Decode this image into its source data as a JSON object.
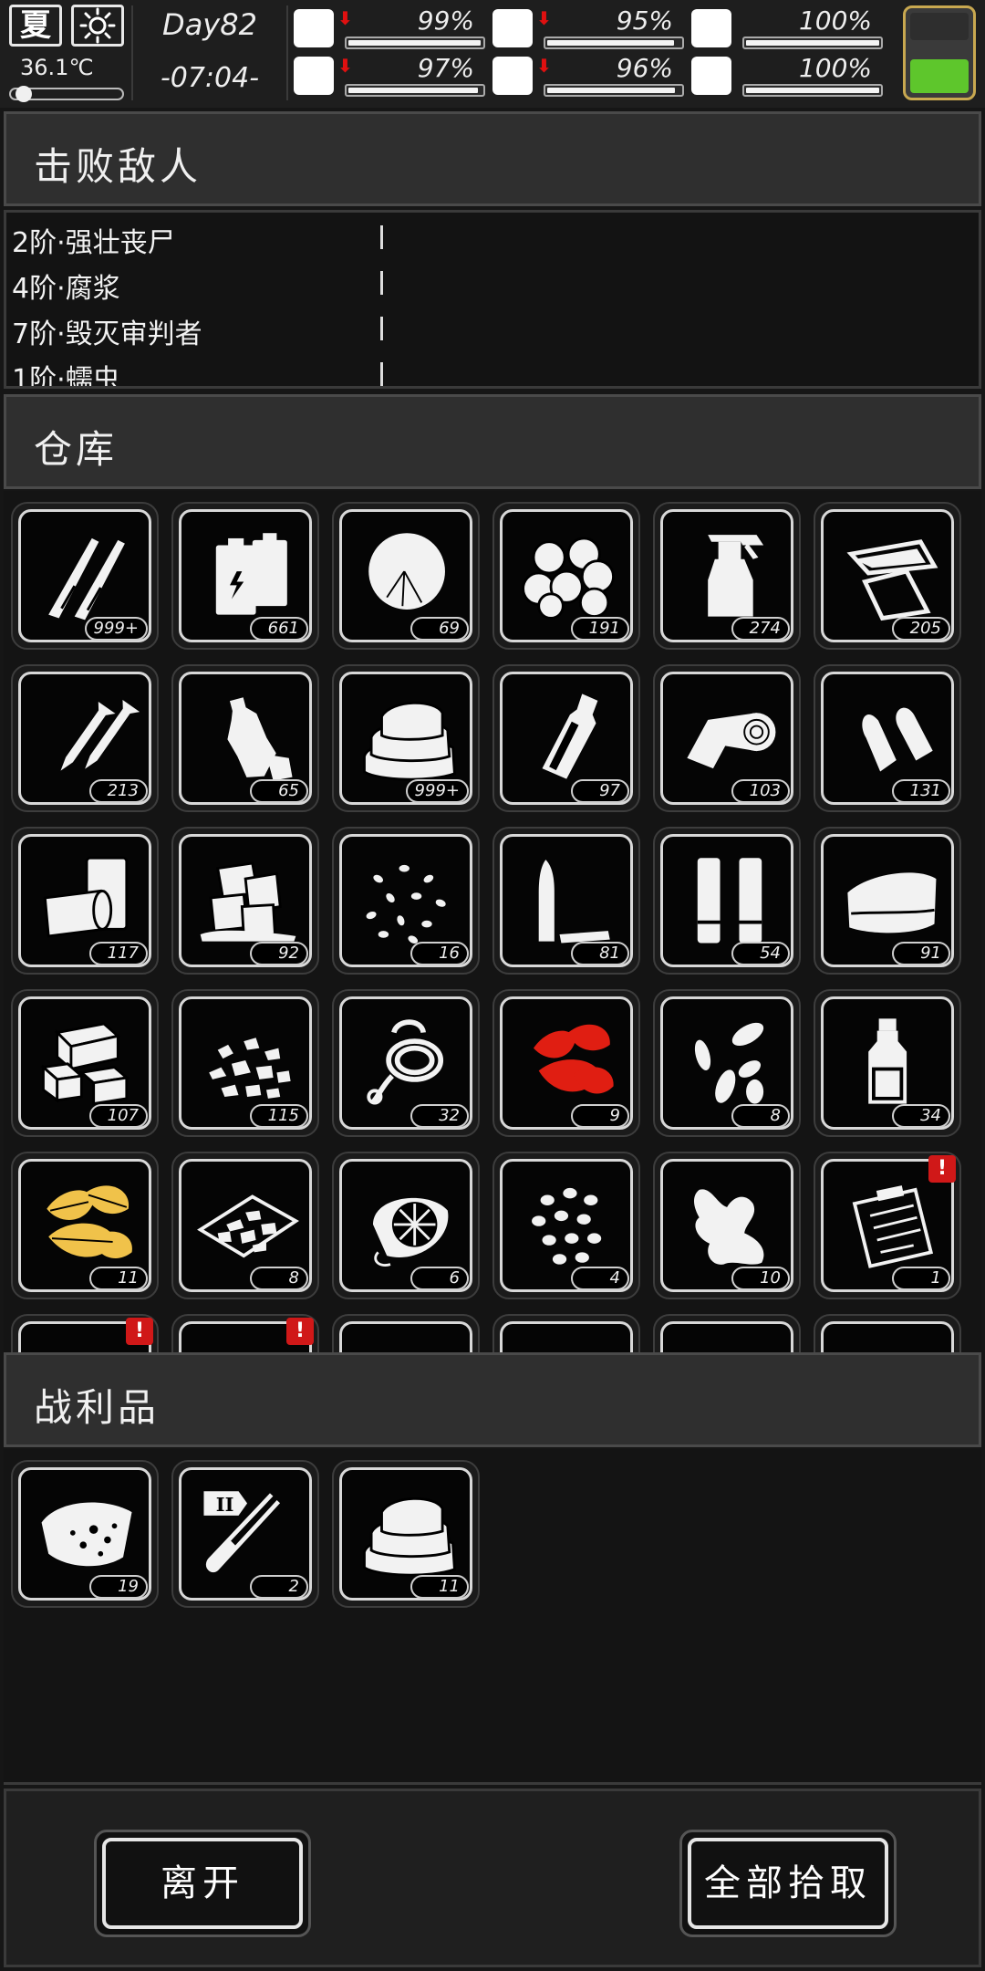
{
  "status": {
    "season": "夏",
    "temperature": "36.1℃",
    "temperature_level": 0.05,
    "day": "Day82",
    "time": "-07:04-",
    "battery_level": 0.42,
    "stats": [
      {
        "name": "health",
        "icon": "first-aid-kit-icon",
        "value": "99%",
        "level": 0.99,
        "declining": true
      },
      {
        "name": "hunger",
        "icon": "stomach-icon",
        "value": "95%",
        "level": 0.95,
        "declining": true
      },
      {
        "name": "immunity",
        "icon": "pill-capsule-icon",
        "value": "100%",
        "level": 1.0,
        "declining": false
      },
      {
        "name": "stamina",
        "icon": "foot-icon",
        "value": "97%",
        "level": 0.97,
        "declining": true
      },
      {
        "name": "thirst",
        "icon": "water-drop-icon",
        "value": "96%",
        "level": 0.96,
        "declining": true
      },
      {
        "name": "mood",
        "icon": "heart-icon",
        "value": "100%",
        "level": 1.0,
        "declining": false
      }
    ]
  },
  "enemies": {
    "title": "击败敌人",
    "items": [
      "2阶·强壮丧尸",
      "4阶·腐浆",
      "7阶·毁灭审判者",
      "1阶·蠕虫"
    ]
  },
  "warehouse": {
    "title": "仓库",
    "items": [
      {
        "icon": "bullets-icon",
        "count": "999+"
      },
      {
        "icon": "batteries-icon",
        "count": "661"
      },
      {
        "icon": "cotton-icon",
        "count": "69"
      },
      {
        "icon": "cotton-balls-icon",
        "count": "191"
      },
      {
        "icon": "spray-bottle-icon",
        "count": "274"
      },
      {
        "icon": "glass-shards-icon",
        "count": "205"
      },
      {
        "icon": "screws-icon",
        "count": "213"
      },
      {
        "icon": "plastic-bottle-icon",
        "count": "65"
      },
      {
        "icon": "cloth-pile-icon",
        "count": "999+"
      },
      {
        "icon": "glass-bottle-icon",
        "count": "97"
      },
      {
        "icon": "bandage-roll-icon",
        "count": "103"
      },
      {
        "icon": "bullet-tips-icon",
        "count": "131"
      },
      {
        "icon": "cans-icon",
        "count": "117"
      },
      {
        "icon": "ice-cubes-icon",
        "count": "92"
      },
      {
        "icon": "seeds-icon",
        "count": "16"
      },
      {
        "icon": "bullet-casing-icon",
        "count": "81"
      },
      {
        "icon": "shotgun-shells-icon",
        "count": "54"
      },
      {
        "icon": "folded-cloth-icon",
        "count": "91"
      },
      {
        "icon": "wood-blocks-icon",
        "count": "107"
      },
      {
        "icon": "gravel-icon",
        "count": "115"
      },
      {
        "icon": "rope-icon",
        "count": "32"
      },
      {
        "icon": "red-herb-icon",
        "count": "9"
      },
      {
        "icon": "almonds-icon",
        "count": "8"
      },
      {
        "icon": "medicine-bottle-icon",
        "count": "34"
      },
      {
        "icon": "yellow-herb-icon",
        "count": "11"
      },
      {
        "icon": "salt-tray-icon",
        "count": "8"
      },
      {
        "icon": "sliced-fruit-icon",
        "count": "6"
      },
      {
        "icon": "beans-icon",
        "count": "4"
      },
      {
        "icon": "ginger-root-icon",
        "count": "10"
      },
      {
        "icon": "clipboard-note-icon",
        "count": "1",
        "alert": "!"
      }
    ]
  },
  "loot": {
    "title": "战利品",
    "items": [
      {
        "icon": "meat-chunk-icon",
        "count": "19"
      },
      {
        "icon": "test-tube-icon",
        "count": "2",
        "tier": "II"
      },
      {
        "icon": "cloth-pile-icon",
        "count": "11"
      }
    ]
  },
  "actions": {
    "leave": "离开",
    "take_all": "全部拾取"
  },
  "colors": {
    "red_herb": "#e01e12",
    "yellow_herb": "#f0c24a",
    "battery": "#5ec62c",
    "alert": "#d01818"
  }
}
